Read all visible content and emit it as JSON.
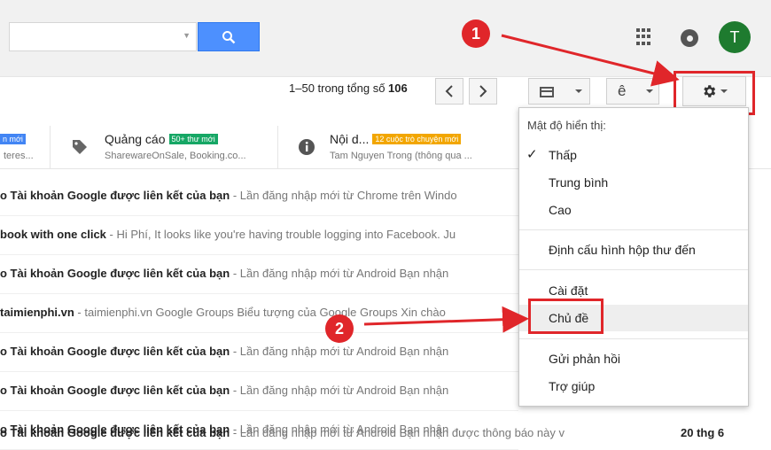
{
  "header": {
    "avatar_letter": "T",
    "accent": "#4d90fe",
    "avatar_color": "#1e7b2f"
  },
  "toolbar": {
    "count_prefix": "1–50 trong tổng số",
    "count_total": "106",
    "input_tools_label": "ê"
  },
  "tabs": [
    {
      "title": "",
      "badge": "n mới",
      "sub": "teres...",
      "badge_color": "#4285f4"
    },
    {
      "title": "Quảng cáo",
      "badge": "50+ thư mới",
      "sub": "SharewareOnSale, Booking.co...",
      "badge_color": "#16a765"
    },
    {
      "title": "Nội d...",
      "badge": "12 cuộc trò chuyện mới",
      "sub": "Tam Nguyen Trong (thông qua ...",
      "badge_color": "#f2a600"
    }
  ],
  "emails": [
    {
      "subject": "o Tài khoản Google được liên kết của bạn",
      "snippet": " - Lần đăng nhập mới từ Chrome trên Windo"
    },
    {
      "subject": "book with one click",
      "snippet": " - Hi Phí, It looks like you're having trouble logging into Facebook. Ju"
    },
    {
      "subject": "o Tài khoản Google được liên kết của bạn",
      "snippet": " - Lần đăng nhập mới từ Android Bạn nhận"
    },
    {
      "subject": " taimienphi.vn",
      "snippet": " - taimienphi.vn Google Groups Biểu tượng của Google Groups Xin chào"
    },
    {
      "subject": "o Tài khoản Google được liên kết của bạn",
      "snippet": " - Lần đăng nhập mới từ Android Bạn nhận"
    },
    {
      "subject": "o Tài khoản Google được liên kết của bạn",
      "snippet": " - Lần đăng nhập mới từ Android Bạn nhận"
    },
    {
      "subject": "o Tài khoản Google được liên kết của bạn",
      "snippet": " - Lần đăng nhập mới từ Android Bạn nhận"
    },
    {
      "subject": "o Tài khoản Google được liên kết của bạn",
      "snippet": " - Lần đăng nhập mới từ Android Bạn nhận được thông báo này v",
      "date": "20 thg 6"
    }
  ],
  "menu": {
    "header": "Mật độ hiển thị:",
    "check": "✓",
    "items": [
      "Thấp",
      "Trung bình",
      "Cao",
      "Định cấu hình hộp thư đến",
      "Cài đặt",
      "Chủ đề",
      "Gửi phản hồi",
      "Trợ giúp"
    ]
  },
  "annotations": {
    "step1": "1",
    "step2": "2",
    "color": "#e0262a"
  }
}
